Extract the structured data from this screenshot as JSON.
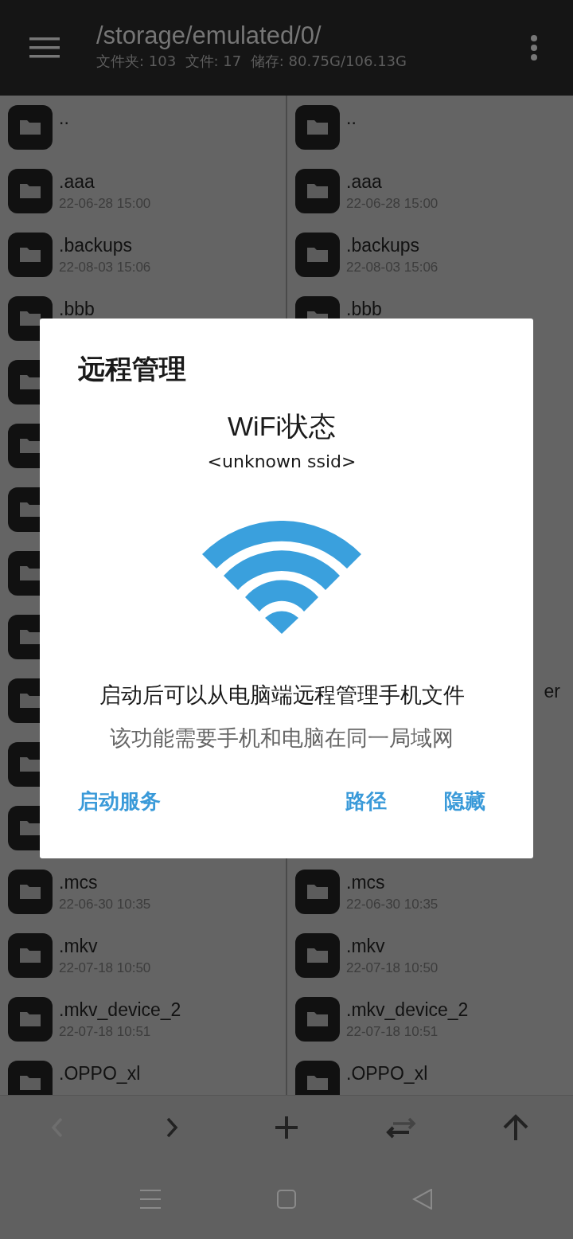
{
  "header": {
    "path": "/storage/emulated/0/",
    "summary": "文件夹: 103  文件: 17  储存: 80.75G/106.13G"
  },
  "panes": [
    {
      "rows": [
        {
          "kind": "folder",
          "name": ".."
        },
        {
          "kind": "folder",
          "name": ".aaa",
          "date": "22-06-28 15:00"
        },
        {
          "kind": "folder",
          "name": ".backups",
          "date": "22-08-03 15:06"
        },
        {
          "kind": "folder",
          "name": ".bbb"
        },
        {
          "kind": "covered"
        },
        {
          "kind": "covered"
        },
        {
          "kind": "covered"
        },
        {
          "kind": "covered"
        },
        {
          "kind": "covered"
        },
        {
          "kind": "covered"
        },
        {
          "kind": "covered"
        },
        {
          "kind": "covered"
        },
        {
          "kind": "folder",
          "name": ".mcs",
          "date": "22-06-30 10:35"
        },
        {
          "kind": "folder",
          "name": ".mkv",
          "date": "22-07-18 10:50"
        },
        {
          "kind": "folder",
          "name": ".mkv_device_2",
          "date": "22-07-18 10:51"
        },
        {
          "kind": "folder",
          "name": ".OPPO_xl"
        }
      ]
    },
    {
      "rows": [
        {
          "kind": "folder",
          "name": ".."
        },
        {
          "kind": "folder",
          "name": ".aaa",
          "date": "22-06-28 15:00"
        },
        {
          "kind": "folder",
          "name": ".backups",
          "date": "22-08-03 15:06"
        },
        {
          "kind": "folder",
          "name": ".bbb"
        },
        {
          "kind": "covered"
        },
        {
          "kind": "covered"
        },
        {
          "kind": "covered"
        },
        {
          "kind": "covered"
        },
        {
          "kind": "covered"
        },
        {
          "kind": "partial",
          "name": "er"
        },
        {
          "kind": "covered"
        },
        {
          "kind": "covered"
        },
        {
          "kind": "folder",
          "name": ".mcs",
          "date": "22-06-30 10:35"
        },
        {
          "kind": "folder",
          "name": ".mkv",
          "date": "22-07-18 10:50"
        },
        {
          "kind": "folder",
          "name": ".mkv_device_2",
          "date": "22-07-18 10:51"
        },
        {
          "kind": "folder",
          "name": ".OPPO_xl"
        }
      ]
    }
  ],
  "toolbar": [
    {
      "kind": "back",
      "disabled": true
    },
    {
      "kind": "forward",
      "disabled": false
    },
    {
      "kind": "add",
      "disabled": false
    },
    {
      "kind": "swap",
      "disabled": false
    },
    {
      "kind": "up",
      "disabled": false
    }
  ],
  "dialog": {
    "title": "远程管理",
    "status_title": "WiFi状态",
    "ssid": "<unknown ssid>",
    "description": "启动后可以从电脑端远程管理手机文件",
    "note": "该功能需要手机和电脑在同一局域网",
    "buttons": [
      {
        "label": "启动服务"
      },
      {
        "label": "路径"
      },
      {
        "label": "隐藏"
      }
    ]
  }
}
